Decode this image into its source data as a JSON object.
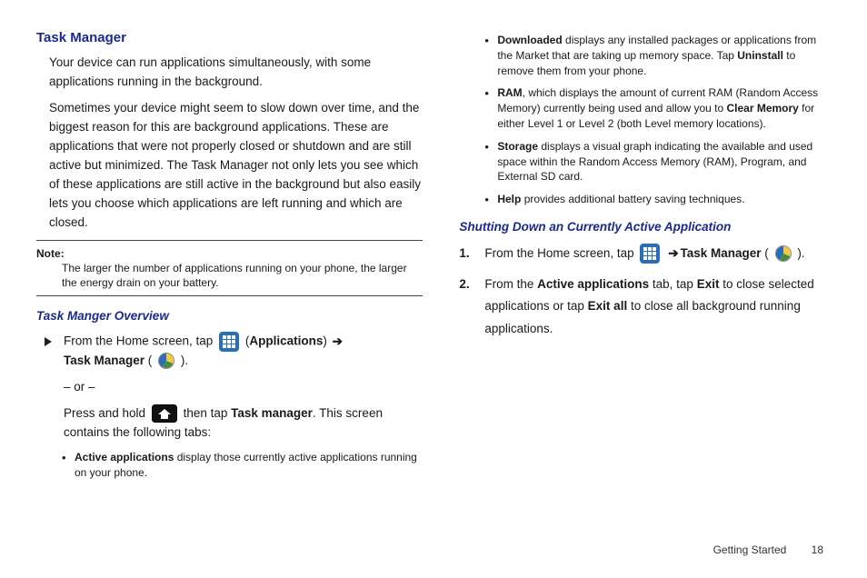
{
  "left": {
    "heading": "Task Manager",
    "p1": "Your device can run applications simultaneously, with some applications running in the background.",
    "p2": "Sometimes your device might seem to slow down over time, and the biggest reason for this are background applications. These are applications that were not properly closed or shutdown and are still active but minimized. The Task Manager not only lets you see which of these applications are still active in the background but also easily lets you choose which applications are left running and which are closed.",
    "note_label": "Note:",
    "note_body": "The larger the number of applications running on your phone, the larger the energy drain on your battery.",
    "subheading": "Task Manger Overview",
    "proc_a": "From the Home screen, tap ",
    "proc_apps_left": " (",
    "proc_apps_bold": "Applications",
    "proc_apps_right": ") ",
    "proc_tm_bold": "Task Manager",
    "proc_tm_paren_l": " ( ",
    "proc_tm_paren_r": " ).",
    "proc_or": "– or –",
    "proc_b1": "Press and hold ",
    "proc_b2": " then tap ",
    "proc_b2_bold": "Task manager",
    "proc_b3": ". This screen contains the following tabs:",
    "bul1_bold": "Active applications",
    "bul1_rest": " display those currently active applications running on your phone."
  },
  "right": {
    "bul2_bold": "Downloaded",
    "bul2_rest_a": " displays any installed packages or applications from the Market that are taking up memory space. Tap ",
    "bul2_bold2": "Uninstall",
    "bul2_rest_b": " to remove them from your phone.",
    "bul3_bold": "RAM",
    "bul3_rest_a": ", which displays the amount of current RAM (Random Access Memory) currently being used and allow you to ",
    "bul3_bold2": "Clear Memory",
    "bul3_rest_b": " for either Level 1 or Level 2 (both Level memory locations).",
    "bul4_bold": "Storage",
    "bul4_rest": " displays a visual graph indicating the available and used space within the Random Access Memory (RAM), Program, and External SD card.",
    "bul5_bold": "Help",
    "bul5_rest": " provides additional battery saving techniques.",
    "subheading": "Shutting Down an Currently Active Application",
    "step1_a": "From the Home screen, tap ",
    "step1_b_bold": "Task Manager",
    "step1_paren_l": " ( ",
    "step1_paren_r": " ).",
    "step2_a": "From the ",
    "step2_bold1": "Active applications",
    "step2_b": " tab, tap ",
    "step2_bold2": "Exit",
    "step2_c": " to close selected applications or tap ",
    "step2_bold3": "Exit all",
    "step2_d": " to close all background running applications.",
    "arrow": "➔"
  },
  "footer": {
    "section": "Getting Started",
    "page": "18"
  }
}
